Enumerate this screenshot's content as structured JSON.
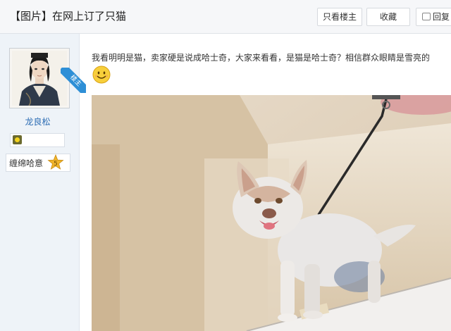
{
  "header": {
    "title": "【图片】在网上订了只猫",
    "buttons": {
      "only_op": "只看楼主",
      "favorite": "收藏",
      "reply": "回复"
    }
  },
  "user": {
    "ribbon": "楼主",
    "name": "龙良松",
    "level_name": "缠绵哈意",
    "level_number": "5"
  },
  "post": {
    "text": "我看明明是猫，卖家硬是说成哈士奇，大家来看看，是猫是哈士奇？相信群众眼睛是雪亮的"
  },
  "icons": {
    "reply": "reply-icon",
    "smiley": "smiley-emoticon",
    "badge": "member-badge-icon",
    "level": "level-star-icon"
  },
  "colors": {
    "link_blue": "#2a6bb3",
    "ribbon_blue": "#2e8fd6",
    "panel_bg": "#eef3f8",
    "title_bg": "#f6f7f9",
    "star_gold": "#f0b42a"
  }
}
